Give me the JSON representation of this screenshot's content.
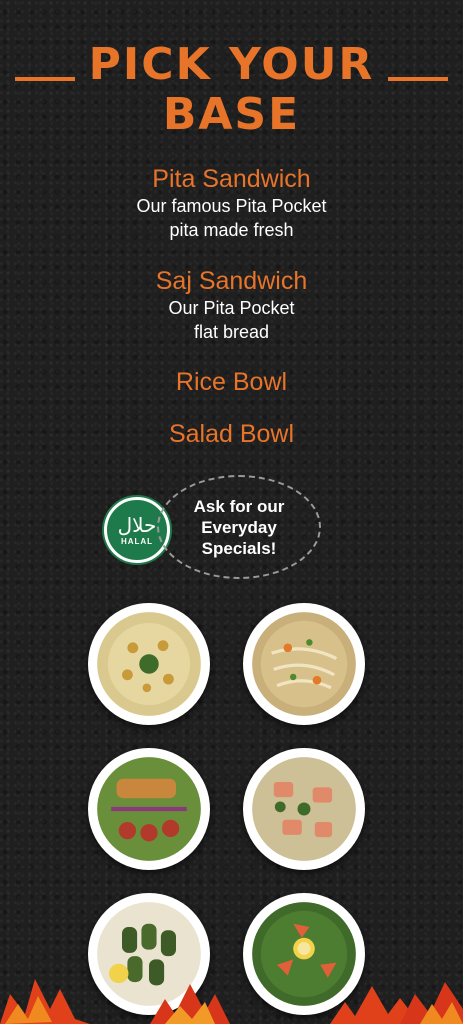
{
  "header": {
    "title_line1": "PICK YOUR",
    "title_line2": "BASE"
  },
  "menu": {
    "items": [
      {
        "name": "Pita Sandwich",
        "desc1": "Our famous Pita Pocket",
        "desc2": "pita made fresh"
      },
      {
        "name": "Saj Sandwich",
        "desc1": "Our Pita Pocket",
        "desc2": "flat bread"
      },
      {
        "name": "Rice Bowl"
      },
      {
        "name": "Salad Bowl"
      }
    ]
  },
  "badge": {
    "arabic": "حلال",
    "label": "HALAL"
  },
  "specials": {
    "text": "Ask for our Everyday Specials!"
  },
  "dishes": [
    {
      "icon": "hummus-icon"
    },
    {
      "icon": "chicken-noodle-soup-icon"
    },
    {
      "icon": "salad-plate-icon"
    },
    {
      "icon": "fish-rice-icon"
    },
    {
      "icon": "stuffed-grape-leaves-icon"
    },
    {
      "icon": "spinach-stew-icon"
    }
  ],
  "colors": {
    "accent": "#e8742a",
    "background": "#1f1f1f",
    "halal_green": "#1e7a4a"
  }
}
